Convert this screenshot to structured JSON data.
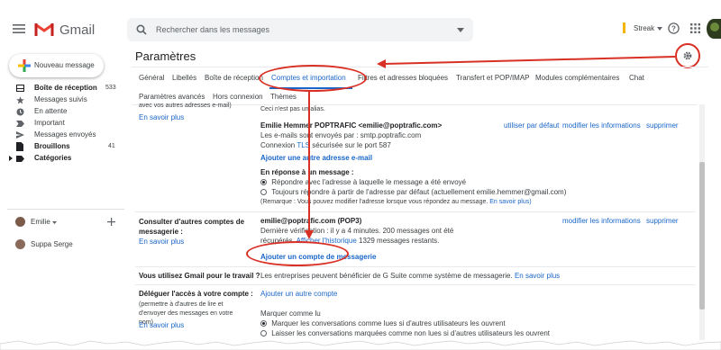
{
  "app": {
    "name": "Gmail"
  },
  "search": {
    "placeholder": "Rechercher dans les messages"
  },
  "topbar": {
    "streak_label": "Streak"
  },
  "compose": {
    "label": "Nouveau message"
  },
  "sidebar": {
    "items": [
      {
        "label": "Boîte de réception",
        "count": "533"
      },
      {
        "label": "Messages suivis",
        "count": ""
      },
      {
        "label": "En attente",
        "count": ""
      },
      {
        "label": "Important",
        "count": ""
      },
      {
        "label": "Messages envoyés",
        "count": ""
      },
      {
        "label": "Brouillons",
        "count": "41"
      },
      {
        "label": "Catégories",
        "count": ""
      }
    ],
    "hangouts": [
      {
        "name": "Emilie"
      },
      {
        "name": "Suppa Serge"
      }
    ]
  },
  "settings": {
    "title": "Paramètres",
    "tabs_row1": [
      "Général",
      "Libellés",
      "Boîte de réception",
      "Comptes et importation",
      "Filtres et adresses bloquées",
      "Transfert et POP/IMAP",
      "Modules complémentaires",
      "Chat"
    ],
    "tabs_row2": [
      "Paramètres avancés",
      "Hors connexion",
      "Thèmes"
    ],
    "top_cut_text": "avec vos autres adresses e-mail)",
    "top_right_text": "Ceci n'est pas un alias.",
    "learn_more": "En savoir plus",
    "send_as": {
      "account_line": "Emilie Hemmer POPTRAFIC <emilie@poptrafic.com>",
      "sent_via": "Les e-mails sont envoyés par : smtp.poptrafic.com",
      "connection_prefix": "Connexion ",
      "connection_tls": "TLS",
      "connection_suffix": " sécurisée sur le port 587",
      "actions": [
        "utiliser par défaut",
        "modifier les informations",
        "supprimer"
      ],
      "add_address": "Ajouter une autre adresse e-mail",
      "reply_heading": "En réponse à un message :",
      "reply_opt1": "Répondre avec l'adresse à laquelle le message a été envoyé",
      "reply_opt2": "Toujours répondre à partir de l'adresse par défaut (actuellement emilie.hemmer@gmail.com)",
      "note": "(Remarque : Vous pouvez modifier l'adresse lorsque vous répondez au message.",
      "note_link": "En savoir plus)"
    },
    "check_mail": {
      "label": "Consulter d'autres comptes de messagerie :",
      "learn_more": "En savoir plus",
      "account": "emilie@poptrafic.com (POP3)",
      "last_check": "Dernière vérification : il y a 4 minutes. 200 messages ont été",
      "retrieved_prefix": "récupérés. ",
      "view_history": "Afficher l'historique",
      "retrieved_suffix": " 1329 messages restants.",
      "actions": [
        "modifier les informations",
        "supprimer"
      ],
      "add_account": "Ajouter un compte de messagerie"
    },
    "gsuite": {
      "label": "Vous utilisez Gmail pour le travail ?",
      "text": "Les entreprises peuvent bénéficier de G Suite comme système de messagerie.",
      "link": "En savoir plus"
    },
    "delegate": {
      "label": "Déléguer l'accès à votre compte :",
      "sub": "(permettre à d'autres de lire et d'envoyer des messages en votre nom)",
      "learn_more": "En savoir plus",
      "add": "Ajouter un autre compte",
      "mark_heading": "Marquer comme lu",
      "mark_opt1": "Marquer les conversations comme lues si d'autres utilisateurs les ouvrent",
      "mark_opt2": "Laisser les conversations marquées comme non lues si d'autres utilisateurs les ouvrent"
    }
  },
  "colors": {
    "accent": "#1a66c8",
    "annotation": "#d93025",
    "gmail_red": "#ea4335"
  }
}
